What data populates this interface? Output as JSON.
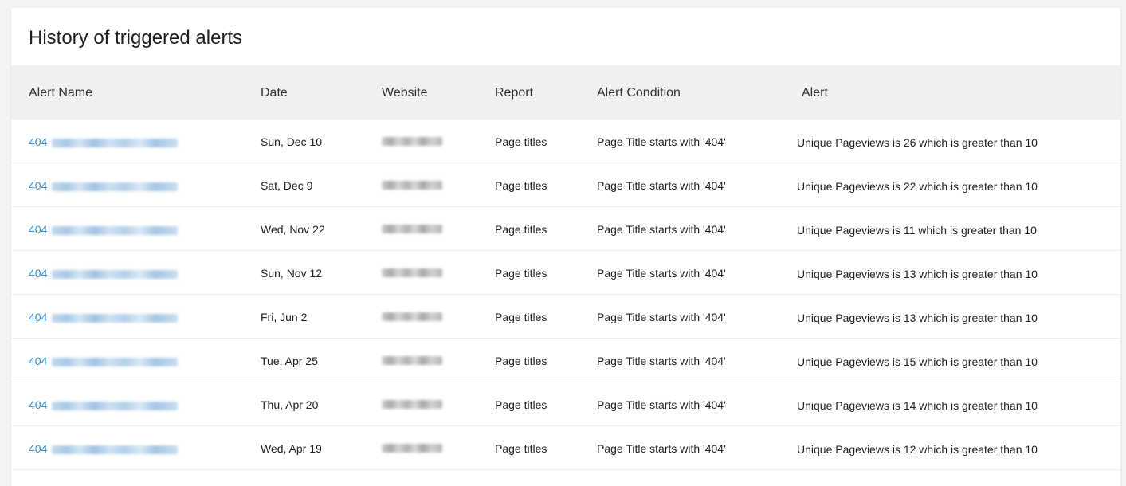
{
  "card": {
    "title": "History of triggered alerts"
  },
  "table": {
    "headers": {
      "alert_name": "Alert Name",
      "date": "Date",
      "website": "Website",
      "report": "Report",
      "condition": "Alert Condition",
      "alert": "Alert"
    },
    "rows": [
      {
        "name_prefix": "404",
        "date": "Sun, Dec 10",
        "report": "Page titles",
        "condition": "Page Title starts with '404'",
        "alert": "Unique Pageviews is 26 which is greater than 10"
      },
      {
        "name_prefix": "404",
        "date": "Sat, Dec 9",
        "report": "Page titles",
        "condition": "Page Title starts with '404'",
        "alert": "Unique Pageviews is 22 which is greater than 10"
      },
      {
        "name_prefix": "404",
        "date": "Wed, Nov 22",
        "report": "Page titles",
        "condition": "Page Title starts with '404'",
        "alert": "Unique Pageviews is 11 which is greater than 10"
      },
      {
        "name_prefix": "404",
        "date": "Sun, Nov 12",
        "report": "Page titles",
        "condition": "Page Title starts with '404'",
        "alert": "Unique Pageviews is 13 which is greater than 10"
      },
      {
        "name_prefix": "404",
        "date": "Fri, Jun 2",
        "report": "Page titles",
        "condition": "Page Title starts with '404'",
        "alert": "Unique Pageviews is 13 which is greater than 10"
      },
      {
        "name_prefix": "404",
        "date": "Tue, Apr 25",
        "report": "Page titles",
        "condition": "Page Title starts with '404'",
        "alert": "Unique Pageviews is 15 which is greater than 10"
      },
      {
        "name_prefix": "404",
        "date": "Thu, Apr 20",
        "report": "Page titles",
        "condition": "Page Title starts with '404'",
        "alert": "Unique Pageviews is 14 which is greater than 10"
      },
      {
        "name_prefix": "404",
        "date": "Wed, Apr 19",
        "report": "Page titles",
        "condition": "Page Title starts with '404'",
        "alert": "Unique Pageviews is 12 which is greater than 10"
      }
    ]
  },
  "colors": {
    "link": "#3a8fd0",
    "header_bg": "#eef0f1",
    "page_bg": "#f2f3f4"
  }
}
